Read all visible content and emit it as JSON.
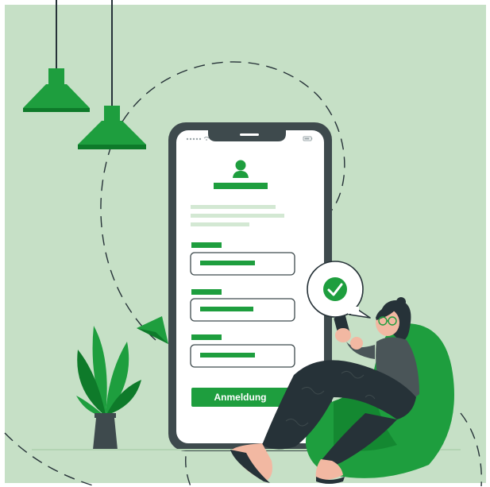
{
  "login_button": {
    "label": "Anmeldung"
  },
  "colors": {
    "background": "#c6e0c6",
    "accent": "#1e9e3e",
    "accent_dark": "#0e7a2a",
    "phone_frame": "#3e4a4d",
    "phone_screen": "#ffffff",
    "placeholder_light": "#d3e8d3",
    "ink": "#263238"
  },
  "icons": {
    "status_signal": "signal-dots-icon",
    "status_wifi": "wifi-icon",
    "status_battery": "battery-icon",
    "avatar": "user-avatar-icon",
    "verified": "checkmark-bubble-icon",
    "paper_plane": "paper-plane-icon"
  }
}
